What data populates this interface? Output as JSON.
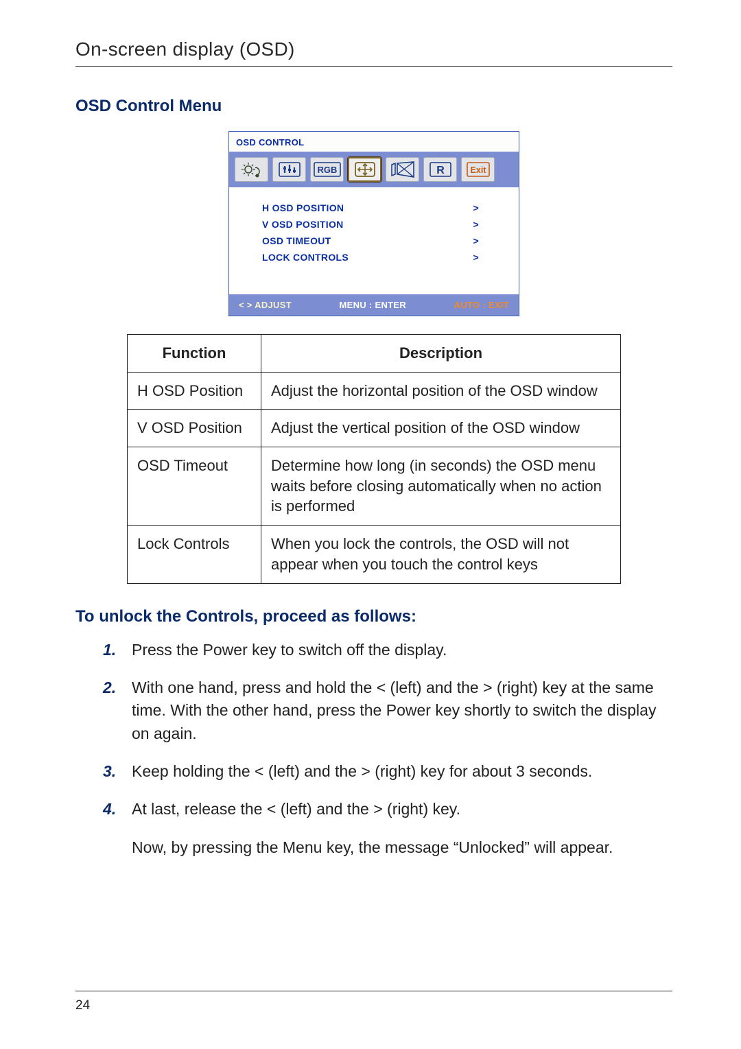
{
  "header": {
    "title": "On-screen display (OSD)"
  },
  "section_heading": "OSD Control Menu",
  "osd": {
    "title": "OSD CONTROL",
    "icons": [
      {
        "name": "brightness-icon",
        "active": false
      },
      {
        "name": "sliders-icon",
        "active": false
      },
      {
        "name": "rgb-icon",
        "active": false
      },
      {
        "name": "position-icon",
        "active": true
      },
      {
        "name": "geometry-icon",
        "active": false
      },
      {
        "name": "reset-icon",
        "active": false
      },
      {
        "name": "exit-icon",
        "active": false
      }
    ],
    "items": [
      {
        "label": "H OSD POSITION",
        "indicator": ">"
      },
      {
        "label": "V OSD POSITION",
        "indicator": ">"
      },
      {
        "label": "OSD TIMEOUT",
        "indicator": ">"
      },
      {
        "label": "LOCK CONTROLS",
        "indicator": ">"
      }
    ],
    "footer": {
      "adjust": "<  >  ADJUST",
      "enter": "MENU : ENTER",
      "exit": "AUTO : EXIT"
    }
  },
  "table": {
    "headers": {
      "function": "Function",
      "description": "Description"
    },
    "rows": [
      {
        "fn": "H OSD Position",
        "desc": "Adjust the horizontal position of the OSD window"
      },
      {
        "fn": "V OSD Position",
        "desc": "Adjust the vertical position of the OSD window"
      },
      {
        "fn": "OSD Timeout",
        "desc": "Determine how long (in seconds) the OSD menu waits before closing automatically when no action is performed"
      },
      {
        "fn": "Lock Controls",
        "desc": "When you lock the controls, the OSD will not appear when you touch the control keys"
      }
    ]
  },
  "unlock": {
    "heading": "To unlock the Controls, proceed as follows:",
    "steps": [
      {
        "n": "1.",
        "text": "Press the Power key to switch off the display."
      },
      {
        "n": "2.",
        "text": "With one hand, press and hold the < (left) and the > (right) key at the same time. With the other hand, press the Power key shortly to switch the display on again."
      },
      {
        "n": "3.",
        "text": "Keep holding the < (left) and the > (right) key for about 3 seconds."
      },
      {
        "n": "4.",
        "text": "At last, release the < (left) and the > (right) key."
      }
    ],
    "follow": "Now, by pressing the Menu key, the message “Unlocked” will appear."
  },
  "page_number": "24"
}
